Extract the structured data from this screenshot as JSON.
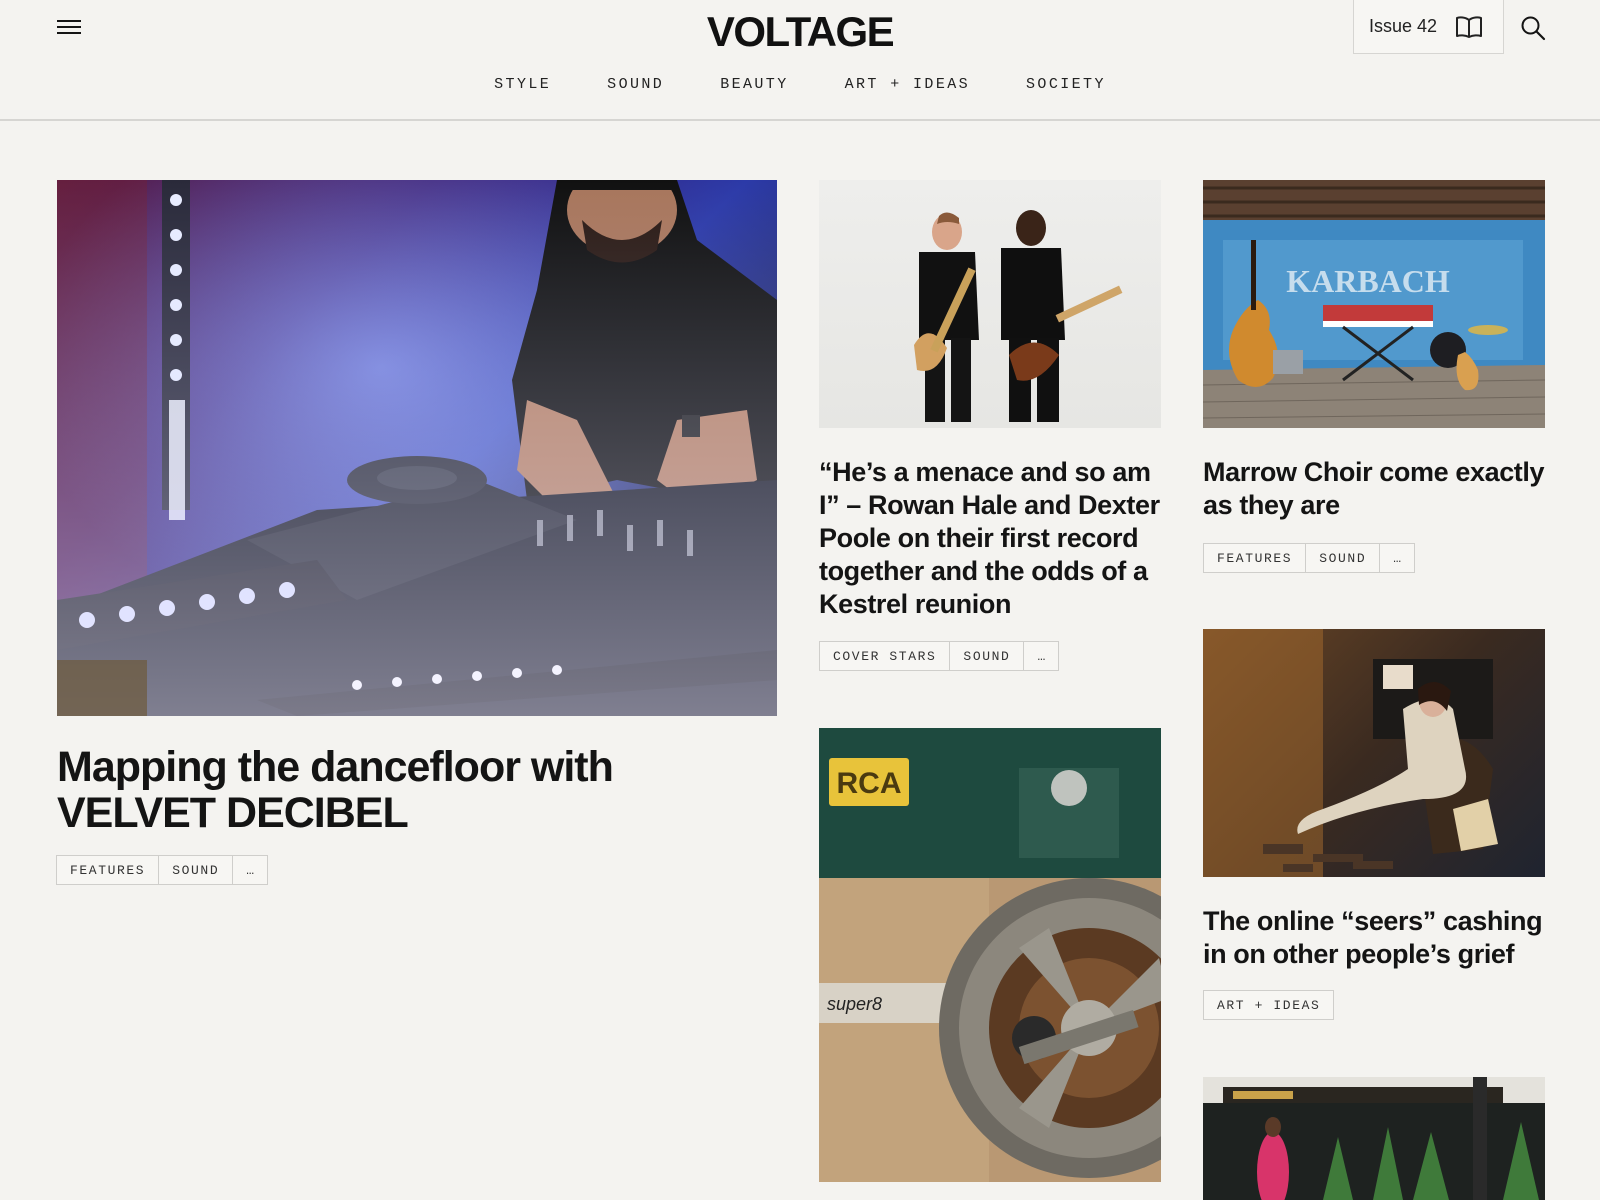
{
  "site": {
    "logo": "VOLTAGE",
    "issue_label": "Issue 42",
    "icons": {
      "menu": "hamburger-menu-icon",
      "issue": "open-book-icon",
      "search": "search-icon"
    }
  },
  "nav": {
    "items": [
      {
        "label": "STYLE"
      },
      {
        "label": "SOUND"
      },
      {
        "label": "BEAUTY"
      },
      {
        "label": "ART + IDEAS"
      },
      {
        "label": "SOCIETY"
      }
    ]
  },
  "articles": {
    "featured": {
      "headline_line1": "Mapping the dancefloor with",
      "headline_line2": "VELVET DECIBEL",
      "tags": [
        "FEATURES",
        "SOUND",
        "…"
      ]
    },
    "col2_top": {
      "headline": "“He’s a menace and so am I” – Rowan Hale and Dexter Poole on their first record together and the odds of a Kestrel reunion",
      "tags": [
        "COVER STARS",
        "SOUND",
        "…"
      ]
    },
    "col3_top": {
      "headline": "Marrow Choir come exactly as they are",
      "tags": [
        "FEATURES",
        "SOUND",
        "…"
      ]
    },
    "col3_mid": {
      "headline": "The online “seers” cashing in on other people’s grief",
      "tags": [
        "ART + IDEAS"
      ]
    },
    "col2_bottom": {
      "logo_text": "RCA",
      "brand_text": "super8"
    },
    "stage_banner": "KARBACH"
  }
}
